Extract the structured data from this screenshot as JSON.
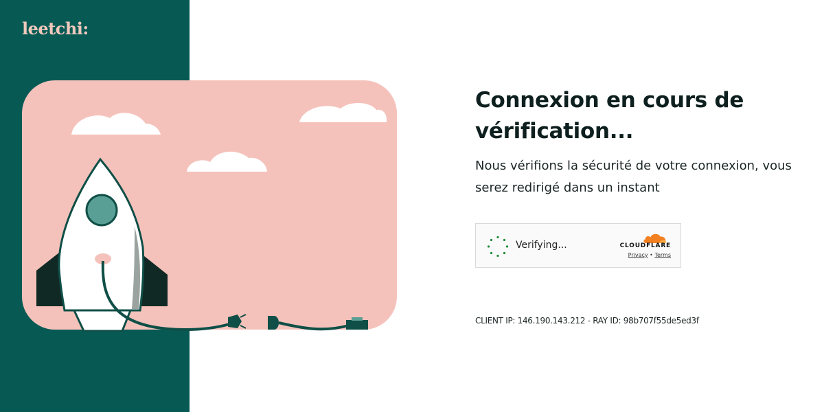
{
  "brand": {
    "logo_text": "leetchi:"
  },
  "main": {
    "title": "Connexion en cours de vérification...",
    "subtitle": "Nous vérifions la sécurité de votre connexion, vous serez redirigé dans un instant"
  },
  "widget": {
    "status_label": "Verifying...",
    "provider_name": "CLOUDFLARE",
    "privacy_label": "Privacy",
    "separator": "•",
    "terms_label": "Terms"
  },
  "footer": {
    "client_info": "CLIENT IP: 146.190.143.212 - RAY ID: 98b707f55de5ed3f"
  },
  "colors": {
    "side_panel": "#075a54",
    "illustration_bg": "#f5c2bb",
    "logo": "#f0c9bc",
    "cloudflare_orange": "#f38020"
  }
}
